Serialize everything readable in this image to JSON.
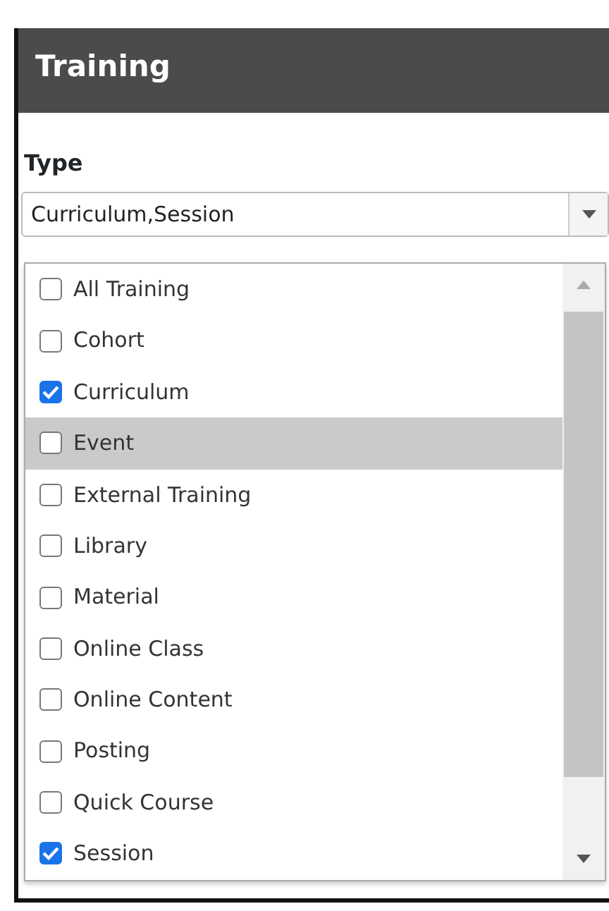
{
  "panel": {
    "title": "Training"
  },
  "type_field": {
    "label": "Type",
    "value": "Curriculum,Session"
  },
  "options": [
    {
      "label": "All Training",
      "checked": false,
      "highlighted": false
    },
    {
      "label": "Cohort",
      "checked": false,
      "highlighted": false
    },
    {
      "label": "Curriculum",
      "checked": true,
      "highlighted": false
    },
    {
      "label": "Event",
      "checked": false,
      "highlighted": true
    },
    {
      "label": "External Training",
      "checked": false,
      "highlighted": false
    },
    {
      "label": "Library",
      "checked": false,
      "highlighted": false
    },
    {
      "label": "Material",
      "checked": false,
      "highlighted": false
    },
    {
      "label": "Online Class",
      "checked": false,
      "highlighted": false
    },
    {
      "label": "Online Content",
      "checked": false,
      "highlighted": false
    },
    {
      "label": "Posting",
      "checked": false,
      "highlighted": false
    },
    {
      "label": "Quick Course",
      "checked": false,
      "highlighted": false
    },
    {
      "label": "Session",
      "checked": true,
      "highlighted": false
    }
  ]
}
